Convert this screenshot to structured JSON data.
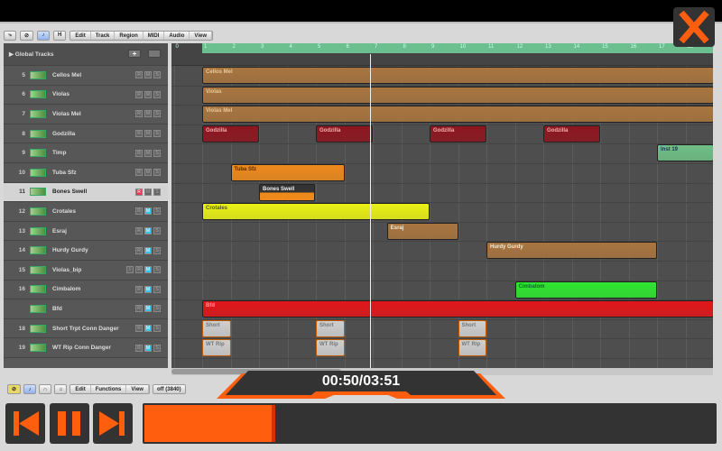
{
  "toolbar": {
    "buttons": [
      "⤷",
      "⊘",
      "♪",
      "H"
    ],
    "menus": [
      "Edit",
      "Track",
      "Region",
      "MIDI",
      "Audio",
      "View"
    ]
  },
  "global_tracks": {
    "label": "▶ Global Tracks",
    "add": "+"
  },
  "ruler": {
    "bars": [
      "0",
      "1",
      "2",
      "3",
      "4",
      "5",
      "6",
      "7",
      "8",
      "9",
      "10",
      "11",
      "12",
      "13",
      "14",
      "15",
      "16",
      "17",
      "18"
    ]
  },
  "tracks": [
    {
      "num": "5",
      "name": "Cellos Mel",
      "mute": false
    },
    {
      "num": "6",
      "name": "Violas",
      "mute": false
    },
    {
      "num": "7",
      "name": "Violas Mel",
      "mute": false
    },
    {
      "num": "8",
      "name": "Godzilla",
      "mute": false
    },
    {
      "num": "9",
      "name": "Timp",
      "mute": false
    },
    {
      "num": "10",
      "name": "Tuba Sfz",
      "mute": false
    },
    {
      "num": "11",
      "name": "Bones Swell",
      "mute": false,
      "selected": true,
      "record": true
    },
    {
      "num": "12",
      "name": "Crotales",
      "mute": true
    },
    {
      "num": "13",
      "name": "Esraj",
      "mute": true
    },
    {
      "num": "14",
      "name": "Hurdy Gurdy",
      "mute": true
    },
    {
      "num": "15",
      "name": "Violas_bip",
      "mute": true,
      "input": true
    },
    {
      "num": "16",
      "name": "Cimbalom",
      "mute": true
    },
    {
      "num": "",
      "name": "Bfd",
      "mute": true
    },
    {
      "num": "18",
      "name": "Short Trpt Conn Danger",
      "mute": true
    },
    {
      "num": "19",
      "name": "WT Rip Conn Danger",
      "mute": true
    }
  ],
  "track_buttons": {
    "r": "R",
    "m": "M",
    "s": "S",
    "i": "I"
  },
  "regions": [
    {
      "row": 0,
      "name": "Cellos Mel",
      "start": 1,
      "end": 19,
      "color": "#a8753f",
      "text": "#e8c99a"
    },
    {
      "row": 1,
      "name": "Violas",
      "start": 1,
      "end": 19,
      "color": "#a8753f",
      "text": "#e8c99a"
    },
    {
      "row": 2,
      "name": "Violas Mel",
      "start": 1,
      "end": 19,
      "color": "#a8753f",
      "text": "#e8c99a"
    },
    {
      "row": 3,
      "name": "Godzilla",
      "start": 1,
      "end": 3,
      "color": "#8e1620",
      "text": "#f3b0b0"
    },
    {
      "row": 3,
      "name": "Godzilla",
      "start": 5,
      "end": 7,
      "color": "#8e1620",
      "text": "#f3b0b0"
    },
    {
      "row": 3,
      "name": "Godzilla",
      "start": 9,
      "end": 11,
      "color": "#8e1620",
      "text": "#f3b0b0"
    },
    {
      "row": 3,
      "name": "Godzilla",
      "start": 13,
      "end": 15,
      "color": "#8e1620",
      "text": "#f3b0b0"
    },
    {
      "row": 4,
      "name": "Inst 19",
      "start": 17,
      "end": 19,
      "color": "#6fbf86",
      "text": "#235"
    },
    {
      "row": 5,
      "name": "Tuba Sfz",
      "start": 2,
      "end": 6,
      "color": "#ee8a1c",
      "text": "#5a2a00"
    },
    {
      "row": 6,
      "name": "Bones Swell",
      "start": 3,
      "end": 5,
      "color": "#ee8a1c",
      "text": "#eee"
    },
    {
      "row": 7,
      "name": "Crotales",
      "start": 1,
      "end": 9,
      "color": "#eaf215",
      "text": "#553"
    },
    {
      "row": 8,
      "name": "Esraj",
      "start": 7.5,
      "end": 10,
      "color": "#a8753f",
      "text": "#eed"
    },
    {
      "row": 9,
      "name": "Hurdy Gurdy",
      "start": 11,
      "end": 17,
      "color": "#a8753f",
      "text": "#eed"
    },
    {
      "row": 11,
      "name": "Cimbalom",
      "start": 12,
      "end": 17,
      "color": "#2fe62f",
      "text": "#163"
    },
    {
      "row": 12,
      "name": "Bfd",
      "start": 1,
      "end": 19,
      "color": "#e0161a",
      "text": "#f99"
    },
    {
      "row": 13,
      "name": "Short",
      "start": 1,
      "end": 2,
      "color": "#cfcfcf",
      "text": "#777"
    },
    {
      "row": 13,
      "name": "Short",
      "start": 5,
      "end": 6,
      "color": "#cfcfcf",
      "text": "#777"
    },
    {
      "row": 13,
      "name": "Short",
      "start": 10,
      "end": 11,
      "color": "#cfcfcf",
      "text": "#777"
    },
    {
      "row": 14,
      "name": "WT Rip",
      "start": 1,
      "end": 2,
      "color": "#cfcfcf",
      "text": "#777"
    },
    {
      "row": 14,
      "name": "WT Rip",
      "start": 5,
      "end": 6,
      "color": "#cfcfcf",
      "text": "#777"
    },
    {
      "row": 14,
      "name": "WT Rip",
      "start": 10,
      "end": 11,
      "color": "#cfcfcf",
      "text": "#777"
    }
  ],
  "playhead_bar": 6.9,
  "toolbar2": {
    "menus": [
      "Edit",
      "Functions",
      "View"
    ],
    "snap": "off (3840)"
  },
  "player": {
    "time": "00:50/03:51",
    "progress": 0.23,
    "accent": "#ff5e0e"
  }
}
